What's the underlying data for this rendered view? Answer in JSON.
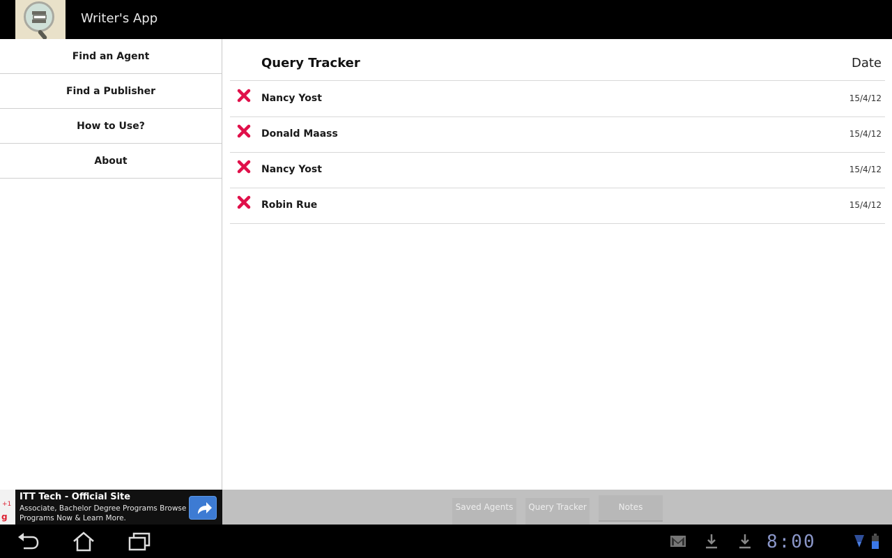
{
  "app": {
    "title": "Writer's App",
    "logo_icon": "magnifier-books-icon"
  },
  "sidebar": {
    "items": [
      {
        "label": "Find an Agent"
      },
      {
        "label": "Find a Publisher"
      },
      {
        "label": "How to Use?"
      },
      {
        "label": "About"
      }
    ]
  },
  "tracker": {
    "title": "Query Tracker",
    "date_header": "Date",
    "delete_icon": "x-icon",
    "accent_color": "#e0104a",
    "rows": [
      {
        "name": "Nancy Yost",
        "date": "15/4/12"
      },
      {
        "name": "Donald Maass",
        "date": "15/4/12"
      },
      {
        "name": "Nancy Yost",
        "date": "15/4/12"
      },
      {
        "name": "Robin Rue",
        "date": "15/4/12"
      }
    ]
  },
  "ad": {
    "plus_one": "+1",
    "g_label": "g",
    "title": "ITT Tech - Official Site",
    "text": "Associate, Bachelor Degree Programs Browse Programs Now & Learn More.",
    "button_icon": "share-arrow-icon"
  },
  "tabs": [
    {
      "label": "Saved Agents"
    },
    {
      "label": "Query Tracker"
    },
    {
      "label": "Notes"
    }
  ],
  "system_bar": {
    "nav": [
      "back-icon",
      "home-icon",
      "recent-apps-icon"
    ],
    "notifications": [
      "gmail-icon",
      "download-icon",
      "download-icon"
    ],
    "clock": "8:00",
    "status": [
      "wifi-icon",
      "battery-icon"
    ]
  }
}
